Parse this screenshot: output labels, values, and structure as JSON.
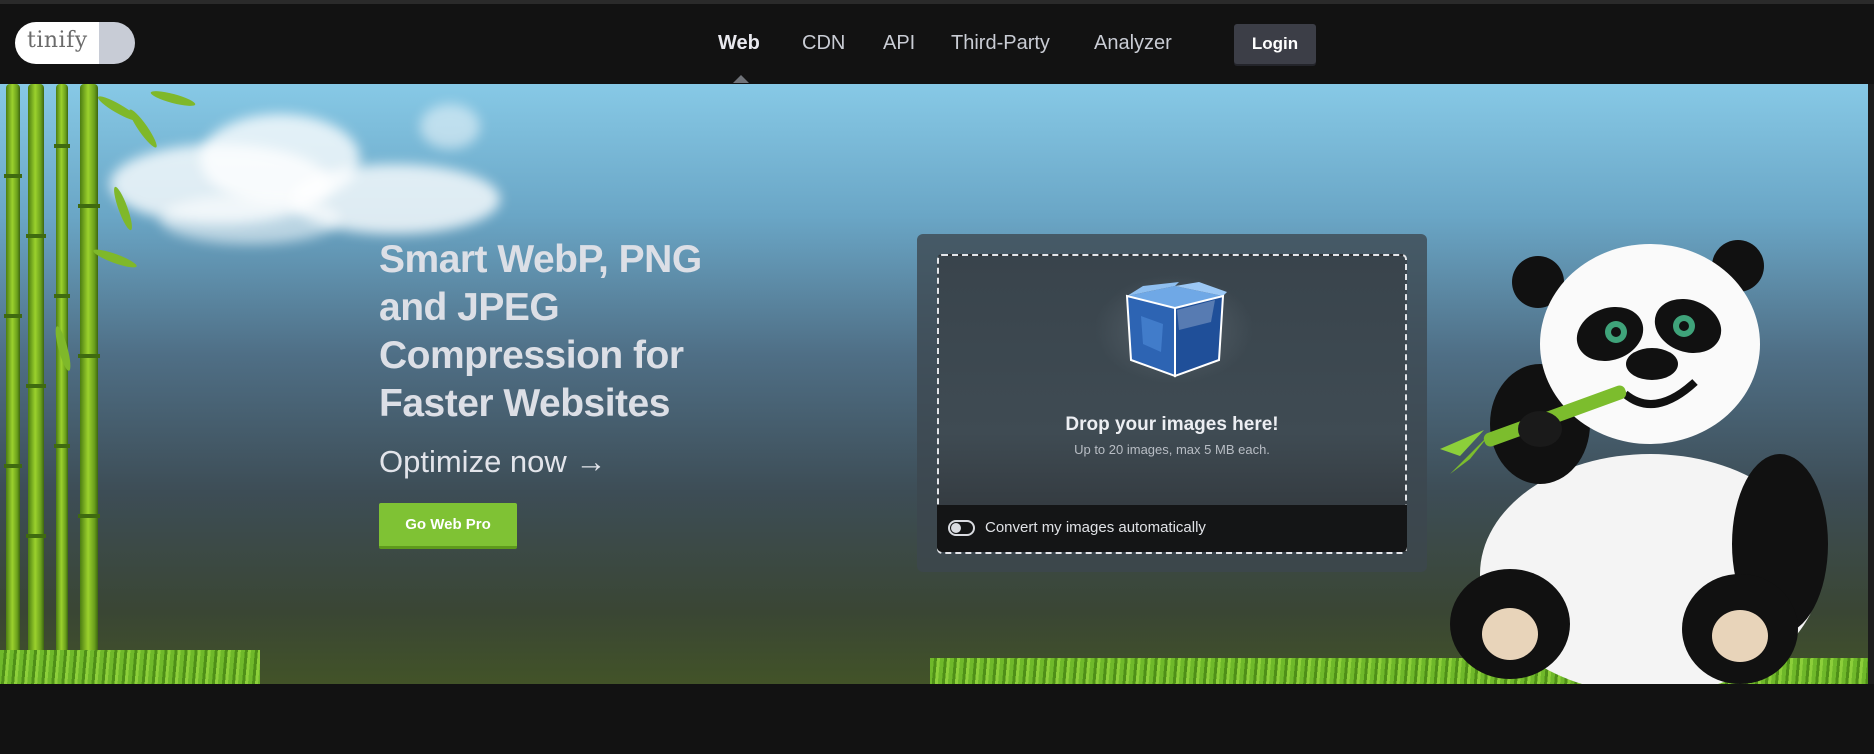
{
  "brand": {
    "logo_text": "tinify"
  },
  "nav": {
    "items": [
      {
        "label": "Web",
        "active": true
      },
      {
        "label": "CDN",
        "active": false
      },
      {
        "label": "API",
        "active": false
      },
      {
        "label": "Third-Party",
        "active": false
      },
      {
        "label": "Analyzer",
        "active": false
      }
    ],
    "login_label": "Login"
  },
  "hero": {
    "headline_lines": [
      "Smart WebP, PNG",
      "and JPEG",
      "Compression for",
      "Faster Websites"
    ],
    "optimize_link": "Optimize now →",
    "cta_label": "Go Web Pro"
  },
  "dropzone": {
    "title": "Drop your images here!",
    "subtitle": "Up to 20 images, max 5 MB each.",
    "auto_convert_label": "Convert my images automatically",
    "auto_convert_enabled": false
  },
  "icons": [
    "box-icon",
    "panda-mascot",
    "toggle-switch"
  ],
  "colors": {
    "page_bg": "#121212",
    "accent_green": "#7fc234",
    "login_bg": "#3c3e47",
    "box_blue": "#2f6fbf"
  }
}
